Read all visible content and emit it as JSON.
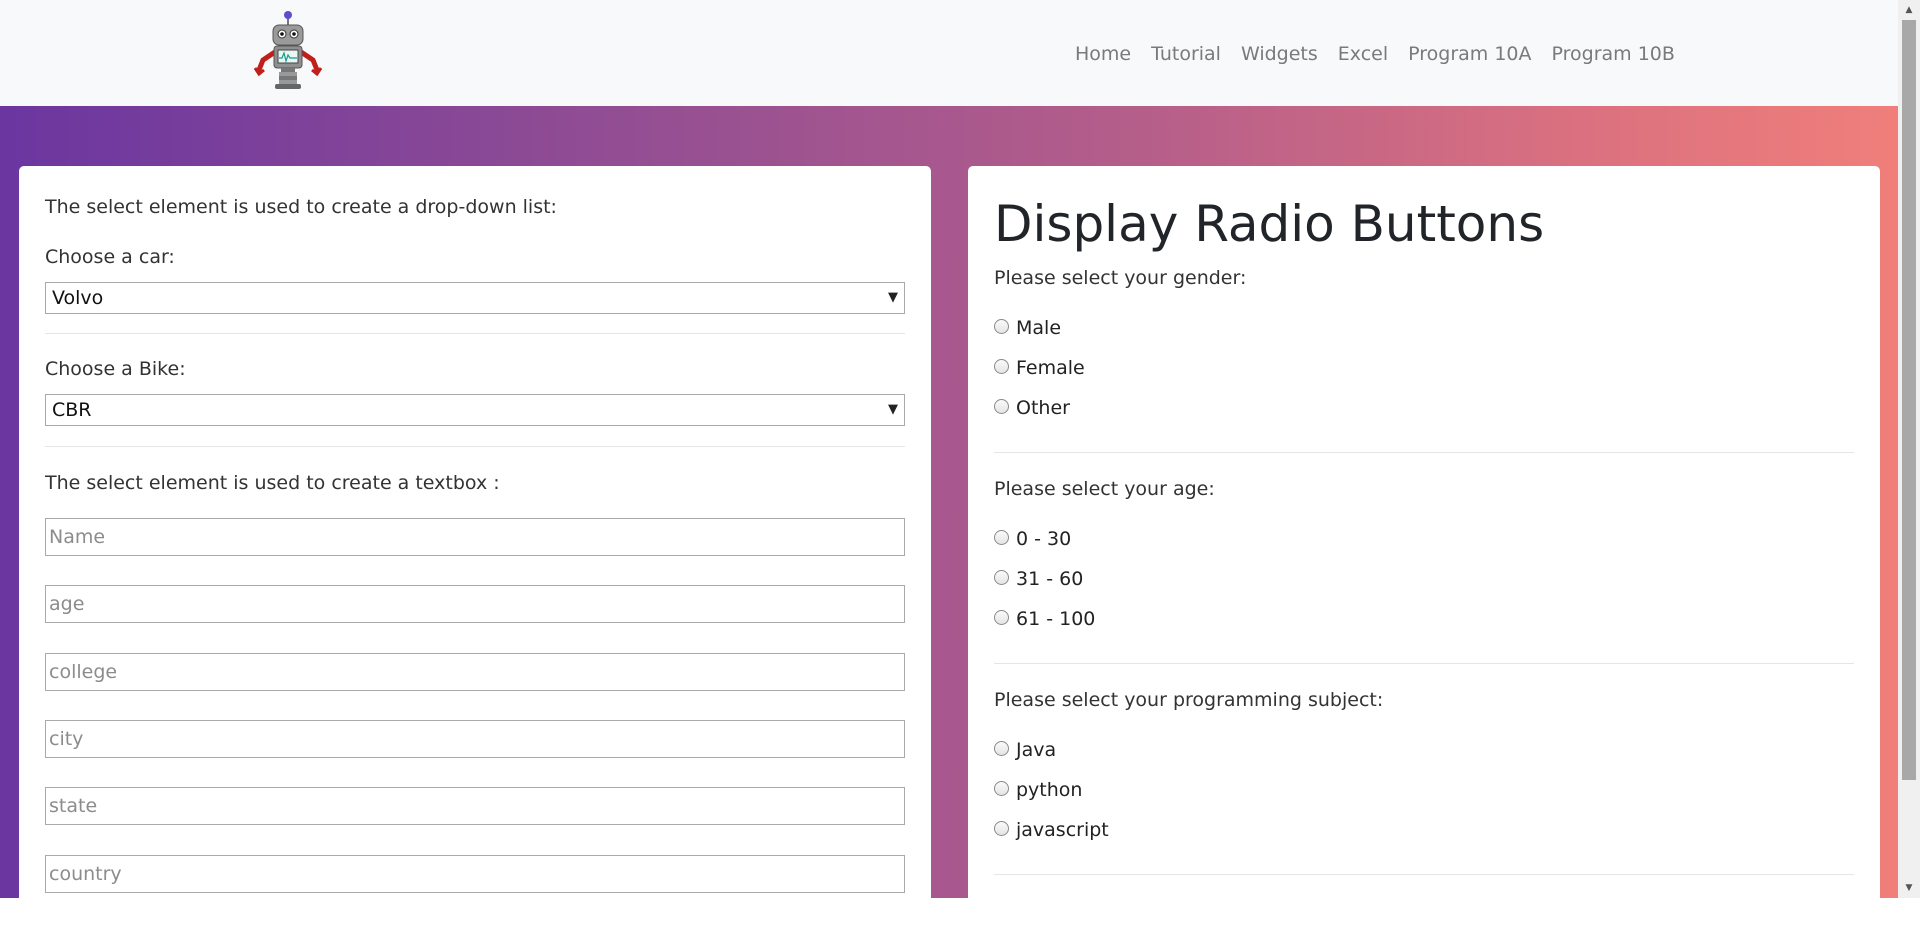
{
  "nav": {
    "links": [
      "Home",
      "Tutorial",
      "Widgets",
      "Excel",
      "Program 10A",
      "Program 10B"
    ]
  },
  "left_card": {
    "intro_text": "The select element is used to create a drop-down list:",
    "car_label": "Choose a car:",
    "car_value": "Volvo",
    "bike_label": "Choose a Bike:",
    "bike_value": "CBR",
    "textbox_intro": "The select element is used to create a textbox :",
    "textboxes": [
      {
        "placeholder": "Name"
      },
      {
        "placeholder": "age"
      },
      {
        "placeholder": "college"
      },
      {
        "placeholder": "city"
      },
      {
        "placeholder": "state"
      },
      {
        "placeholder": "country"
      }
    ]
  },
  "right_card": {
    "title": "Display Radio Buttons",
    "groups": [
      {
        "prompt": "Please select your gender:",
        "options": [
          "Male",
          "Female",
          "Other"
        ]
      },
      {
        "prompt": "Please select your age:",
        "options": [
          "0 - 30",
          "31 - 60",
          "61 - 100"
        ]
      },
      {
        "prompt": "Please select your programming subject:",
        "options": [
          "Java",
          "python",
          "javascript"
        ]
      }
    ]
  },
  "colors": {
    "gradient_start": "#6b36a0",
    "gradient_end": "#f07f7b",
    "navbar_bg": "#f8f9fa",
    "nav_link": "#7a7a7a"
  }
}
